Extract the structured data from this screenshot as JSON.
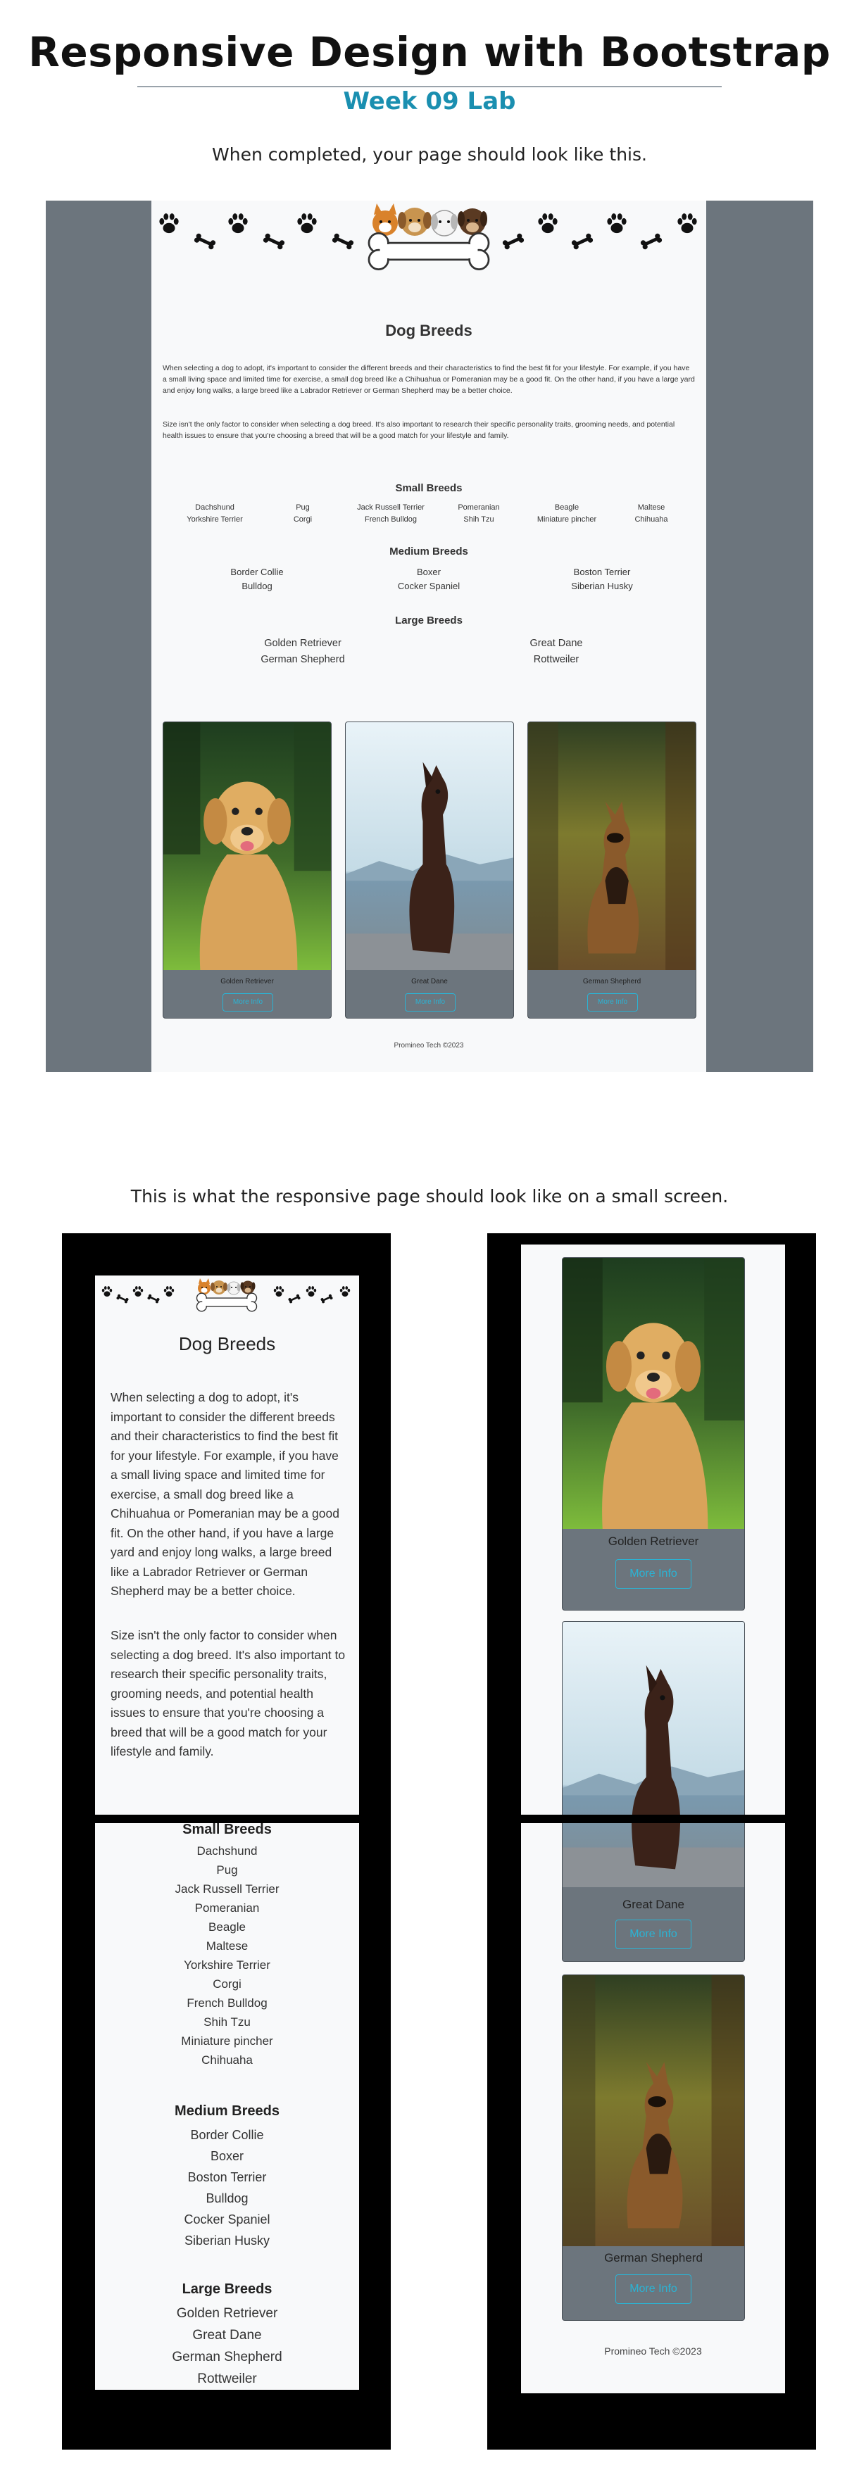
{
  "header": {
    "title": "Responsive Design with Bootstrap",
    "subtitle": "Week 09 Lab",
    "intro": "When completed, your page should look like this.",
    "small_screen_caption": "This is what the responsive page should look like on a small screen."
  },
  "page": {
    "heading": "Dog Breeds",
    "paragraph1": "When selecting a dog to adopt, it's important to consider the different breeds and their characteristics to find the best fit for your lifestyle. For example, if you have a small living space and limited time for exercise, a small dog breed like a Chihuahua or Pomeranian may be a good fit. On the other hand, if you have a large yard and enjoy long walks, a large breed like a Labrador Retriever or German Shepherd may be a better choice.",
    "paragraph2": "Size isn't the only factor to consider when selecting a dog breed. It's also important to research their specific personality traits, grooming needs, and potential health issues to ensure that you're choosing a breed that will be a good match for your lifestyle and family.",
    "small_breeds": {
      "heading": "Small Breeds",
      "columns": [
        [
          "Dachshund",
          "Yorkshire Terrier"
        ],
        [
          "Pug",
          "Corgi"
        ],
        [
          "Jack Russell Terrier",
          "French Bulldog"
        ],
        [
          "Pomeranian",
          "Shih Tzu"
        ],
        [
          "Beagle",
          "Miniature pincher"
        ],
        [
          "Maltese",
          "Chihuaha"
        ]
      ],
      "list": [
        "Dachshund",
        "Pug",
        "Jack Russell Terrier",
        "Pomeranian",
        "Beagle",
        "Maltese",
        "Yorkshire Terrier",
        "Corgi",
        "French Bulldog",
        "Shih Tzu",
        "Miniature pincher",
        "Chihuaha"
      ]
    },
    "medium_breeds": {
      "heading": "Medium Breeds",
      "columns": [
        [
          "Border Collie",
          "Bulldog"
        ],
        [
          "Boxer",
          "Cocker Spaniel"
        ],
        [
          "Boston Terrier",
          "Siberian Husky"
        ]
      ],
      "list": [
        "Border Collie",
        "Boxer",
        "Boston Terrier",
        "Bulldog",
        "Cocker Spaniel",
        "Siberian Husky"
      ]
    },
    "large_breeds": {
      "heading": "Large Breeds",
      "columns": [
        [
          "Golden Retriever",
          "German Shepherd"
        ],
        [
          "Great Dane",
          "Rottweiler"
        ]
      ],
      "list": [
        "Golden Retriever",
        "Great Dane",
        "German Shepherd",
        "Rottweiler"
      ]
    },
    "cards": [
      {
        "name": "Golden Retriever",
        "button": "More Info"
      },
      {
        "name": "Great Dane",
        "button": "More Info"
      },
      {
        "name": "German Shepherd",
        "button": "More Info"
      }
    ],
    "footer": "Promineo Tech ©2023"
  },
  "colors": {
    "accent": "#1a8fb0",
    "card_bg": "#6c757d",
    "button_outline": "#2bb3d4",
    "page_bg": "#f8f9fa"
  }
}
